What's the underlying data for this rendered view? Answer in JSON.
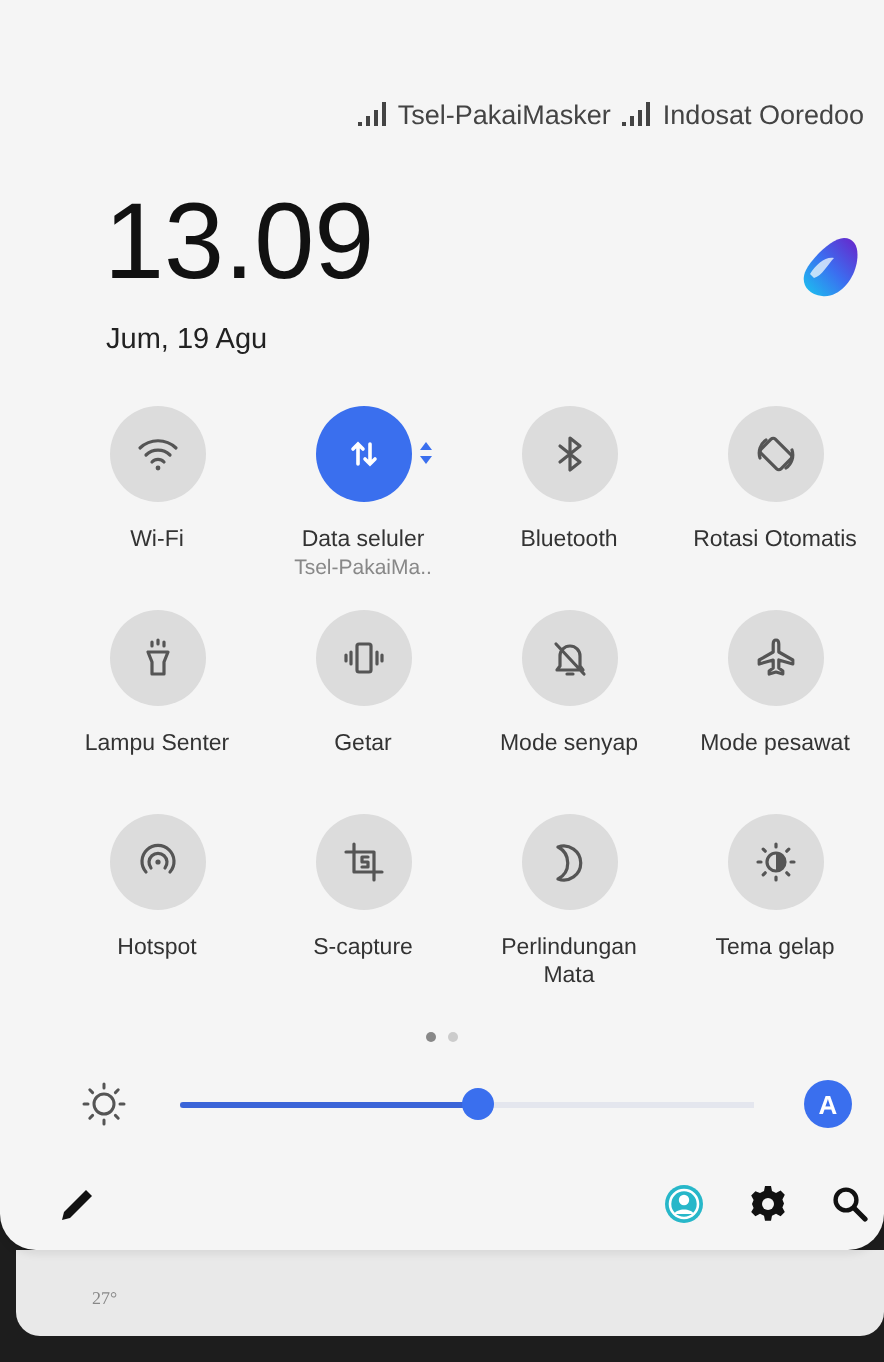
{
  "carriers": [
    {
      "name": "Tsel-PakaiMasker"
    },
    {
      "name": "Indosat Ooredoo"
    }
  ],
  "clock": {
    "time": "13.09",
    "date": "Jum, 19 Agu"
  },
  "tiles": [
    {
      "label": "Wi-Fi",
      "on": false
    },
    {
      "label": "Data seluler",
      "sublabel": "Tsel-PakaiMa..",
      "on": true
    },
    {
      "label": "Bluetooth",
      "on": false
    },
    {
      "label": "Rotasi Otomatis",
      "on": false
    },
    {
      "label": "Lampu Senter",
      "on": false
    },
    {
      "label": "Getar",
      "on": false
    },
    {
      "label": "Mode senyap",
      "on": false
    },
    {
      "label": "Mode pesawat",
      "on": false
    },
    {
      "label": "Hotspot",
      "on": false
    },
    {
      "label": "S-capture",
      "on": false
    },
    {
      "label": "Perlindungan Mata",
      "on": false
    },
    {
      "label": "Tema gelap",
      "on": false
    }
  ],
  "pages": [
    {
      "selected": true
    },
    {
      "selected": false
    }
  ],
  "brightness": {
    "level": 0.52,
    "auto_label": "A",
    "auto_on": true
  },
  "background_widget": {
    "temperature": "27°"
  }
}
